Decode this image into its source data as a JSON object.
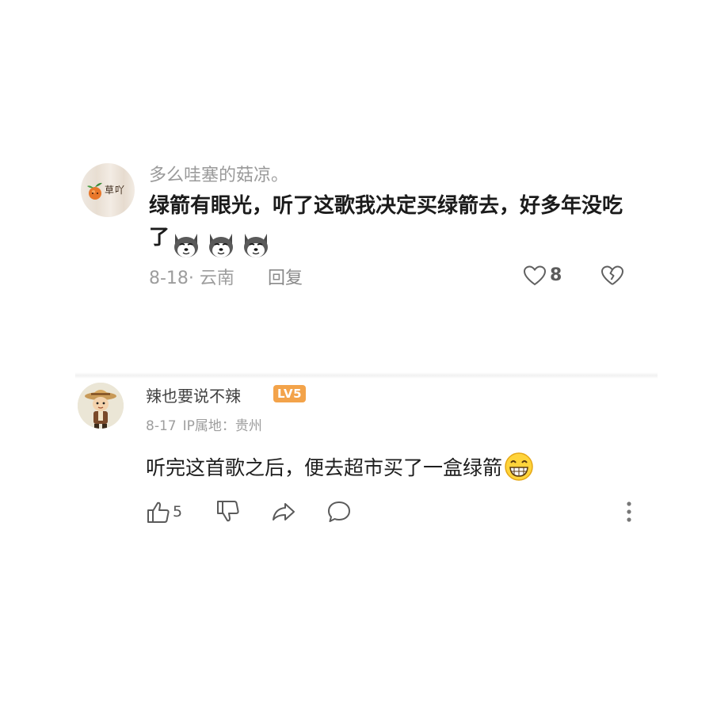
{
  "comments": [
    {
      "username": "多么哇塞的菇凉。",
      "avatar_text": "草吖",
      "text": "绿箭有眼光，听了这歌我决定买绿箭去，好多年没吃了",
      "emojis": [
        "dog-emoji",
        "dog-emoji",
        "dog-emoji"
      ],
      "meta": "8-18· 云南",
      "reply_label": "回复",
      "like_count": "8"
    },
    {
      "username": "辣也要说不辣",
      "level_badge": "LV5",
      "date": "8-17",
      "ip_location": "IP属地：贵州",
      "text": "听完这首歌之后，便去超市买了一盒绿箭",
      "emoji": "grinning-face-emoji",
      "like_count": "5"
    }
  ],
  "colors": {
    "badge": "#f3a34a",
    "text_primary": "#1b1b1b",
    "text_secondary": "#9a9a9a"
  }
}
